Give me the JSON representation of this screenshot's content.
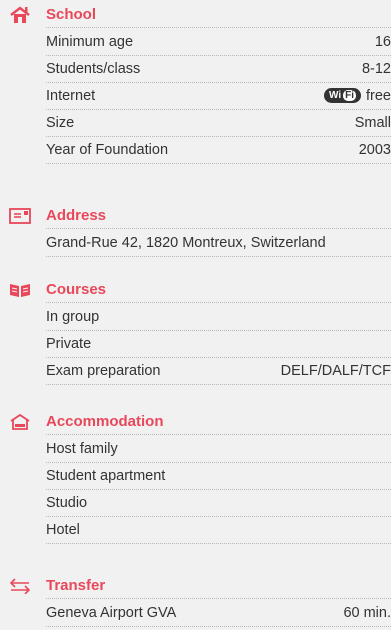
{
  "colors": {
    "accent": "#e8485a",
    "text": "#333333",
    "background": "#f1f1f1"
  },
  "school": {
    "title": "School",
    "icon": "house-icon",
    "rows": [
      {
        "label": "Minimum age",
        "value": "16"
      },
      {
        "label": "Students/class",
        "value": "8-12"
      },
      {
        "label": "Internet",
        "value": "free",
        "badge": "WiFi"
      },
      {
        "label": "Size",
        "value": "Small"
      },
      {
        "label": "Year of Foundation",
        "value": "2003"
      }
    ]
  },
  "address": {
    "title": "Address",
    "icon": "envelope-icon",
    "text": "Grand-Rue 42, 1820 Montreux, Switzerland"
  },
  "courses": {
    "title": "Courses",
    "icon": "book-icon",
    "rows": [
      {
        "label": "In group",
        "value": ""
      },
      {
        "label": "Private",
        "value": ""
      },
      {
        "label": "Exam preparation",
        "value": "DELF/DALF/TCF"
      }
    ]
  },
  "accommodation": {
    "title": "Accommodation",
    "icon": "home-roof-icon",
    "rows": [
      {
        "label": "Host family"
      },
      {
        "label": "Student apartment"
      },
      {
        "label": "Studio"
      },
      {
        "label": "Hotel"
      }
    ]
  },
  "transfer": {
    "title": "Transfer",
    "icon": "arrows-icon",
    "rows": [
      {
        "label": "Geneva Airport GVA",
        "value": "60 min."
      }
    ]
  }
}
